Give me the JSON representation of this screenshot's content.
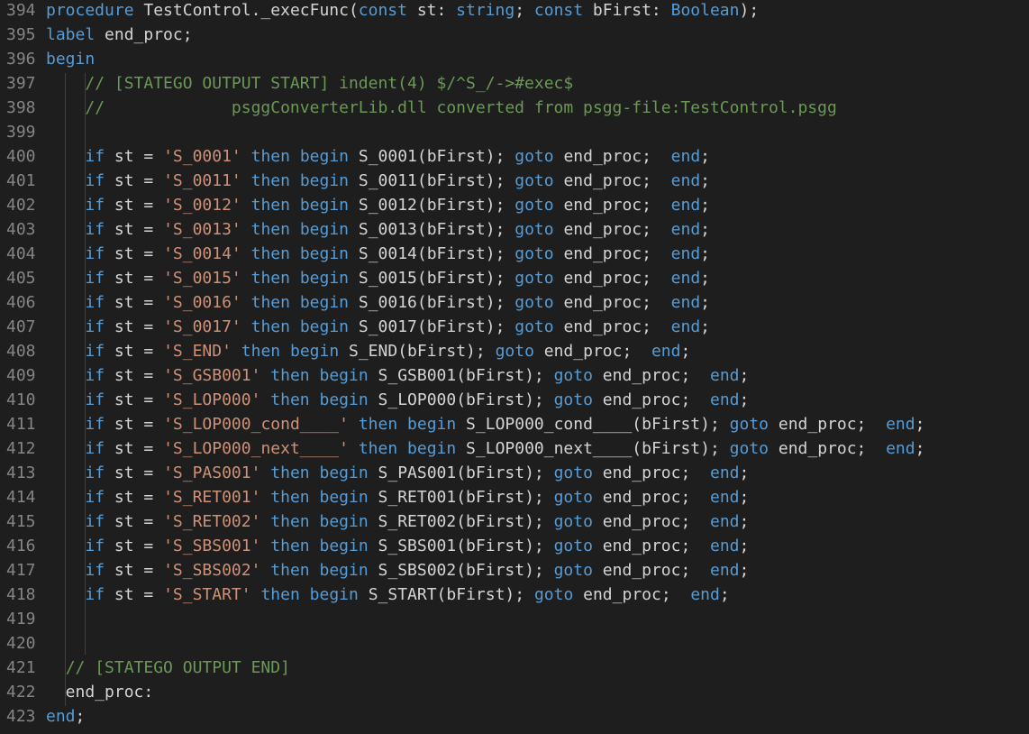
{
  "editor": {
    "language": "Pascal",
    "theme_colors": {
      "background": "#1e1e1e",
      "keyword": "#569cd6",
      "string": "#ce9178",
      "comment": "#6a9955",
      "text": "#d4d4d4",
      "line_number": "#858585"
    },
    "lines": [
      {
        "num": "394",
        "tokens": [
          [
            "pl",
            ""
          ],
          [
            "kw",
            "procedure"
          ],
          [
            "pl",
            " TestControl._execFunc("
          ],
          [
            "kw",
            "const"
          ],
          [
            "pl",
            " st: "
          ],
          [
            "tp",
            "string"
          ],
          [
            "pl",
            "; "
          ],
          [
            "kw",
            "const"
          ],
          [
            "pl",
            " bFirst: "
          ],
          [
            "tp",
            "Boolean"
          ],
          [
            "pl",
            ");"
          ]
        ]
      },
      {
        "num": "395",
        "tokens": [
          [
            "pl",
            ""
          ],
          [
            "kw",
            "label"
          ],
          [
            "pl",
            " end_proc;"
          ]
        ]
      },
      {
        "num": "396",
        "tokens": [
          [
            "pl",
            ""
          ],
          [
            "kw",
            "begin"
          ]
        ]
      },
      {
        "num": "397",
        "tokens": [
          [
            "pl",
            "    "
          ],
          [
            "cm",
            "// [STATEGO OUTPUT START] indent(4) $/^S_/->#exec$"
          ]
        ]
      },
      {
        "num": "398",
        "tokens": [
          [
            "pl",
            "    "
          ],
          [
            "cm",
            "//             psggConverterLib.dll converted from psgg-file:TestControl.psgg"
          ]
        ]
      },
      {
        "num": "399",
        "tokens": []
      },
      {
        "num": "400",
        "tokens": [
          [
            "pl",
            "    "
          ],
          [
            "kw",
            "if"
          ],
          [
            "pl",
            " st = "
          ],
          [
            "st",
            "'S_0001'"
          ],
          [
            "pl",
            " "
          ],
          [
            "kw",
            "then"
          ],
          [
            "pl",
            " "
          ],
          [
            "kw",
            "begin"
          ],
          [
            "pl",
            " S_0001(bFirst); "
          ],
          [
            "kw",
            "goto"
          ],
          [
            "pl",
            " end_proc;  "
          ],
          [
            "kw",
            "end"
          ],
          [
            "pl",
            ";"
          ]
        ]
      },
      {
        "num": "401",
        "tokens": [
          [
            "pl",
            "    "
          ],
          [
            "kw",
            "if"
          ],
          [
            "pl",
            " st = "
          ],
          [
            "st",
            "'S_0011'"
          ],
          [
            "pl",
            " "
          ],
          [
            "kw",
            "then"
          ],
          [
            "pl",
            " "
          ],
          [
            "kw",
            "begin"
          ],
          [
            "pl",
            " S_0011(bFirst); "
          ],
          [
            "kw",
            "goto"
          ],
          [
            "pl",
            " end_proc;  "
          ],
          [
            "kw",
            "end"
          ],
          [
            "pl",
            ";"
          ]
        ]
      },
      {
        "num": "402",
        "tokens": [
          [
            "pl",
            "    "
          ],
          [
            "kw",
            "if"
          ],
          [
            "pl",
            " st = "
          ],
          [
            "st",
            "'S_0012'"
          ],
          [
            "pl",
            " "
          ],
          [
            "kw",
            "then"
          ],
          [
            "pl",
            " "
          ],
          [
            "kw",
            "begin"
          ],
          [
            "pl",
            " S_0012(bFirst); "
          ],
          [
            "kw",
            "goto"
          ],
          [
            "pl",
            " end_proc;  "
          ],
          [
            "kw",
            "end"
          ],
          [
            "pl",
            ";"
          ]
        ]
      },
      {
        "num": "403",
        "tokens": [
          [
            "pl",
            "    "
          ],
          [
            "kw",
            "if"
          ],
          [
            "pl",
            " st = "
          ],
          [
            "st",
            "'S_0013'"
          ],
          [
            "pl",
            " "
          ],
          [
            "kw",
            "then"
          ],
          [
            "pl",
            " "
          ],
          [
            "kw",
            "begin"
          ],
          [
            "pl",
            " S_0013(bFirst); "
          ],
          [
            "kw",
            "goto"
          ],
          [
            "pl",
            " end_proc;  "
          ],
          [
            "kw",
            "end"
          ],
          [
            "pl",
            ";"
          ]
        ]
      },
      {
        "num": "404",
        "tokens": [
          [
            "pl",
            "    "
          ],
          [
            "kw",
            "if"
          ],
          [
            "pl",
            " st = "
          ],
          [
            "st",
            "'S_0014'"
          ],
          [
            "pl",
            " "
          ],
          [
            "kw",
            "then"
          ],
          [
            "pl",
            " "
          ],
          [
            "kw",
            "begin"
          ],
          [
            "pl",
            " S_0014(bFirst); "
          ],
          [
            "kw",
            "goto"
          ],
          [
            "pl",
            " end_proc;  "
          ],
          [
            "kw",
            "end"
          ],
          [
            "pl",
            ";"
          ]
        ]
      },
      {
        "num": "405",
        "tokens": [
          [
            "pl",
            "    "
          ],
          [
            "kw",
            "if"
          ],
          [
            "pl",
            " st = "
          ],
          [
            "st",
            "'S_0015'"
          ],
          [
            "pl",
            " "
          ],
          [
            "kw",
            "then"
          ],
          [
            "pl",
            " "
          ],
          [
            "kw",
            "begin"
          ],
          [
            "pl",
            " S_0015(bFirst); "
          ],
          [
            "kw",
            "goto"
          ],
          [
            "pl",
            " end_proc;  "
          ],
          [
            "kw",
            "end"
          ],
          [
            "pl",
            ";"
          ]
        ]
      },
      {
        "num": "406",
        "tokens": [
          [
            "pl",
            "    "
          ],
          [
            "kw",
            "if"
          ],
          [
            "pl",
            " st = "
          ],
          [
            "st",
            "'S_0016'"
          ],
          [
            "pl",
            " "
          ],
          [
            "kw",
            "then"
          ],
          [
            "pl",
            " "
          ],
          [
            "kw",
            "begin"
          ],
          [
            "pl",
            " S_0016(bFirst); "
          ],
          [
            "kw",
            "goto"
          ],
          [
            "pl",
            " end_proc;  "
          ],
          [
            "kw",
            "end"
          ],
          [
            "pl",
            ";"
          ]
        ]
      },
      {
        "num": "407",
        "tokens": [
          [
            "pl",
            "    "
          ],
          [
            "kw",
            "if"
          ],
          [
            "pl",
            " st = "
          ],
          [
            "st",
            "'S_0017'"
          ],
          [
            "pl",
            " "
          ],
          [
            "kw",
            "then"
          ],
          [
            "pl",
            " "
          ],
          [
            "kw",
            "begin"
          ],
          [
            "pl",
            " S_0017(bFirst); "
          ],
          [
            "kw",
            "goto"
          ],
          [
            "pl",
            " end_proc;  "
          ],
          [
            "kw",
            "end"
          ],
          [
            "pl",
            ";"
          ]
        ]
      },
      {
        "num": "408",
        "tokens": [
          [
            "pl",
            "    "
          ],
          [
            "kw",
            "if"
          ],
          [
            "pl",
            " st = "
          ],
          [
            "st",
            "'S_END'"
          ],
          [
            "pl",
            " "
          ],
          [
            "kw",
            "then"
          ],
          [
            "pl",
            " "
          ],
          [
            "kw",
            "begin"
          ],
          [
            "pl",
            " S_END(bFirst); "
          ],
          [
            "kw",
            "goto"
          ],
          [
            "pl",
            " end_proc;  "
          ],
          [
            "kw",
            "end"
          ],
          [
            "pl",
            ";"
          ]
        ]
      },
      {
        "num": "409",
        "tokens": [
          [
            "pl",
            "    "
          ],
          [
            "kw",
            "if"
          ],
          [
            "pl",
            " st = "
          ],
          [
            "st",
            "'S_GSB001'"
          ],
          [
            "pl",
            " "
          ],
          [
            "kw",
            "then"
          ],
          [
            "pl",
            " "
          ],
          [
            "kw",
            "begin"
          ],
          [
            "pl",
            " S_GSB001(bFirst); "
          ],
          [
            "kw",
            "goto"
          ],
          [
            "pl",
            " end_proc;  "
          ],
          [
            "kw",
            "end"
          ],
          [
            "pl",
            ";"
          ]
        ]
      },
      {
        "num": "410",
        "tokens": [
          [
            "pl",
            "    "
          ],
          [
            "kw",
            "if"
          ],
          [
            "pl",
            " st = "
          ],
          [
            "st",
            "'S_LOP000'"
          ],
          [
            "pl",
            " "
          ],
          [
            "kw",
            "then"
          ],
          [
            "pl",
            " "
          ],
          [
            "kw",
            "begin"
          ],
          [
            "pl",
            " S_LOP000(bFirst); "
          ],
          [
            "kw",
            "goto"
          ],
          [
            "pl",
            " end_proc;  "
          ],
          [
            "kw",
            "end"
          ],
          [
            "pl",
            ";"
          ]
        ]
      },
      {
        "num": "411",
        "tokens": [
          [
            "pl",
            "    "
          ],
          [
            "kw",
            "if"
          ],
          [
            "pl",
            " st = "
          ],
          [
            "st",
            "'S_LOP000_cond____'"
          ],
          [
            "pl",
            " "
          ],
          [
            "kw",
            "then"
          ],
          [
            "pl",
            " "
          ],
          [
            "kw",
            "begin"
          ],
          [
            "pl",
            " S_LOP000_cond____(bFirst); "
          ],
          [
            "kw",
            "goto"
          ],
          [
            "pl",
            " end_proc;  "
          ],
          [
            "kw",
            "end"
          ],
          [
            "pl",
            ";"
          ]
        ]
      },
      {
        "num": "412",
        "tokens": [
          [
            "pl",
            "    "
          ],
          [
            "kw",
            "if"
          ],
          [
            "pl",
            " st = "
          ],
          [
            "st",
            "'S_LOP000_next____'"
          ],
          [
            "pl",
            " "
          ],
          [
            "kw",
            "then"
          ],
          [
            "pl",
            " "
          ],
          [
            "kw",
            "begin"
          ],
          [
            "pl",
            " S_LOP000_next____(bFirst); "
          ],
          [
            "kw",
            "goto"
          ],
          [
            "pl",
            " end_proc;  "
          ],
          [
            "kw",
            "end"
          ],
          [
            "pl",
            ";"
          ]
        ]
      },
      {
        "num": "413",
        "tokens": [
          [
            "pl",
            "    "
          ],
          [
            "kw",
            "if"
          ],
          [
            "pl",
            " st = "
          ],
          [
            "st",
            "'S_PAS001'"
          ],
          [
            "pl",
            " "
          ],
          [
            "kw",
            "then"
          ],
          [
            "pl",
            " "
          ],
          [
            "kw",
            "begin"
          ],
          [
            "pl",
            " S_PAS001(bFirst); "
          ],
          [
            "kw",
            "goto"
          ],
          [
            "pl",
            " end_proc;  "
          ],
          [
            "kw",
            "end"
          ],
          [
            "pl",
            ";"
          ]
        ]
      },
      {
        "num": "414",
        "tokens": [
          [
            "pl",
            "    "
          ],
          [
            "kw",
            "if"
          ],
          [
            "pl",
            " st = "
          ],
          [
            "st",
            "'S_RET001'"
          ],
          [
            "pl",
            " "
          ],
          [
            "kw",
            "then"
          ],
          [
            "pl",
            " "
          ],
          [
            "kw",
            "begin"
          ],
          [
            "pl",
            " S_RET001(bFirst); "
          ],
          [
            "kw",
            "goto"
          ],
          [
            "pl",
            " end_proc;  "
          ],
          [
            "kw",
            "end"
          ],
          [
            "pl",
            ";"
          ]
        ]
      },
      {
        "num": "415",
        "tokens": [
          [
            "pl",
            "    "
          ],
          [
            "kw",
            "if"
          ],
          [
            "pl",
            " st = "
          ],
          [
            "st",
            "'S_RET002'"
          ],
          [
            "pl",
            " "
          ],
          [
            "kw",
            "then"
          ],
          [
            "pl",
            " "
          ],
          [
            "kw",
            "begin"
          ],
          [
            "pl",
            " S_RET002(bFirst); "
          ],
          [
            "kw",
            "goto"
          ],
          [
            "pl",
            " end_proc;  "
          ],
          [
            "kw",
            "end"
          ],
          [
            "pl",
            ";"
          ]
        ]
      },
      {
        "num": "416",
        "tokens": [
          [
            "pl",
            "    "
          ],
          [
            "kw",
            "if"
          ],
          [
            "pl",
            " st = "
          ],
          [
            "st",
            "'S_SBS001'"
          ],
          [
            "pl",
            " "
          ],
          [
            "kw",
            "then"
          ],
          [
            "pl",
            " "
          ],
          [
            "kw",
            "begin"
          ],
          [
            "pl",
            " S_SBS001(bFirst); "
          ],
          [
            "kw",
            "goto"
          ],
          [
            "pl",
            " end_proc;  "
          ],
          [
            "kw",
            "end"
          ],
          [
            "pl",
            ";"
          ]
        ]
      },
      {
        "num": "417",
        "tokens": [
          [
            "pl",
            "    "
          ],
          [
            "kw",
            "if"
          ],
          [
            "pl",
            " st = "
          ],
          [
            "st",
            "'S_SBS002'"
          ],
          [
            "pl",
            " "
          ],
          [
            "kw",
            "then"
          ],
          [
            "pl",
            " "
          ],
          [
            "kw",
            "begin"
          ],
          [
            "pl",
            " S_SBS002(bFirst); "
          ],
          [
            "kw",
            "goto"
          ],
          [
            "pl",
            " end_proc;  "
          ],
          [
            "kw",
            "end"
          ],
          [
            "pl",
            ";"
          ]
        ]
      },
      {
        "num": "418",
        "tokens": [
          [
            "pl",
            "    "
          ],
          [
            "kw",
            "if"
          ],
          [
            "pl",
            " st = "
          ],
          [
            "st",
            "'S_START'"
          ],
          [
            "pl",
            " "
          ],
          [
            "kw",
            "then"
          ],
          [
            "pl",
            " "
          ],
          [
            "kw",
            "begin"
          ],
          [
            "pl",
            " S_START(bFirst); "
          ],
          [
            "kw",
            "goto"
          ],
          [
            "pl",
            " end_proc;  "
          ],
          [
            "kw",
            "end"
          ],
          [
            "pl",
            ";"
          ]
        ]
      },
      {
        "num": "419",
        "tokens": []
      },
      {
        "num": "420",
        "tokens": []
      },
      {
        "num": "421",
        "tokens": [
          [
            "pl",
            "  "
          ],
          [
            "cm",
            "// [STATEGO OUTPUT END]"
          ]
        ]
      },
      {
        "num": "422",
        "tokens": [
          [
            "pl",
            "  end_proc:"
          ]
        ]
      },
      {
        "num": "423",
        "tokens": [
          [
            "pl",
            ""
          ],
          [
            "kw",
            "end"
          ],
          [
            "pl",
            ";"
          ]
        ]
      }
    ]
  }
}
